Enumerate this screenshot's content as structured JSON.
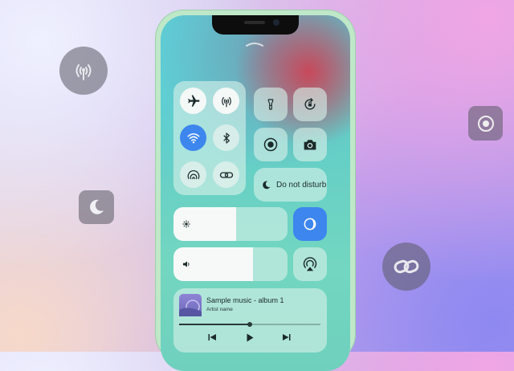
{
  "floating_icons": [
    "antenna-icon",
    "moon-icon",
    "target-icon",
    "link-icon"
  ],
  "control_center": {
    "connectivity": [
      "airplane-icon",
      "cellular-antenna-icon",
      "wifi-icon",
      "bluetooth-icon",
      "airdrop-icon",
      "link-icon"
    ],
    "wifi_active": true,
    "quick_toggles": [
      "flashlight-icon",
      "rotation-lock-icon",
      "record-icon",
      "camera-icon"
    ],
    "do_not_disturb": {
      "label": "Do not disturb",
      "icon": "moon-icon"
    },
    "brightness": {
      "level": 0.55,
      "icon": "sun-icon"
    },
    "volume": {
      "level": 0.7,
      "icon": "speaker-icon"
    },
    "night_shift_icon": "night-shift-icon",
    "airplay_icon": "airplay-icon",
    "music": {
      "title": "Sample music - album 1",
      "artist": "Artist name",
      "progress": 0.5,
      "controls": [
        "previous-icon",
        "play-icon",
        "next-icon"
      ]
    }
  },
  "colors": {
    "accent": "#3d86ee"
  }
}
